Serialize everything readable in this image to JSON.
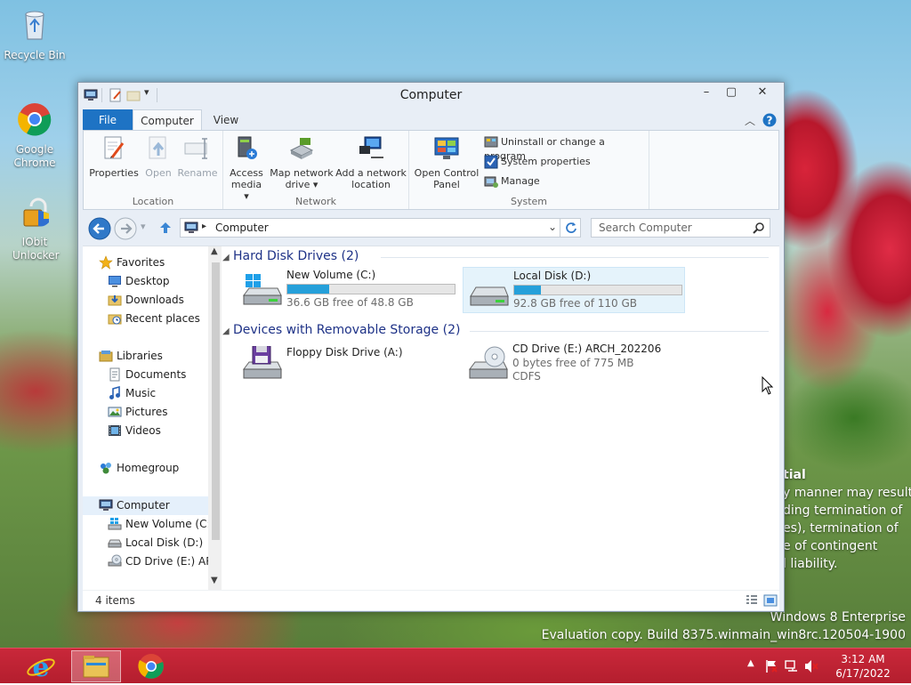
{
  "desktop": {
    "icons": [
      {
        "label": "Recycle Bin"
      },
      {
        "label": "Google Chrome"
      },
      {
        "label": "IObit Unlocker"
      }
    ],
    "watermark": {
      "line1": "Windows 8 Enterprise",
      "line2": "Evaluation copy. Build 8375.winmain_win8rc.120504-1900"
    },
    "behind_window_text": {
      "heading": "tial",
      "line1": "y manner may result",
      "line2": "ding termination of",
      "line3": "es), termination of",
      "line4": "e of contingent",
      "line5": "l liability."
    }
  },
  "window": {
    "title": "Computer",
    "controls": {
      "minimize": "–",
      "maximize": "▢",
      "close": "✕"
    },
    "tabs": [
      {
        "label": "File"
      },
      {
        "label": "Computer",
        "selected": true
      },
      {
        "label": "View"
      }
    ],
    "ribbon": {
      "location": {
        "label": "Location",
        "buttons": [
          {
            "label": "Properties",
            "enabled": true
          },
          {
            "label": "Open",
            "enabled": false
          },
          {
            "label": "Rename",
            "enabled": false
          }
        ]
      },
      "network": {
        "label": "Network",
        "buttons": [
          {
            "line1": "Access",
            "line2": "media ▾"
          },
          {
            "line1": "Map network",
            "line2": "drive ▾"
          },
          {
            "line1": "Add a network",
            "line2": "location"
          }
        ]
      },
      "system": {
        "label": "System",
        "open_cp_line1": "Open Control",
        "open_cp_line2": "Panel",
        "small": [
          {
            "label": "Uninstall or change a program"
          },
          {
            "label": "System properties"
          },
          {
            "label": "Manage"
          }
        ]
      }
    },
    "address": {
      "separator": "▸",
      "path": "Computer"
    },
    "search": {
      "placeholder": "Search Computer"
    },
    "nav_pane": {
      "favorites": {
        "label": "Favorites",
        "items": [
          "Desktop",
          "Downloads",
          "Recent places"
        ]
      },
      "libraries": {
        "label": "Libraries",
        "items": [
          "Documents",
          "Music",
          "Pictures",
          "Videos"
        ]
      },
      "homegroup": {
        "label": "Homegroup"
      },
      "computer": {
        "label": "Computer",
        "items": [
          "New Volume (C:)",
          "Local Disk (D:)",
          "CD Drive (E:) ARC"
        ]
      }
    },
    "content": {
      "groups": [
        {
          "label": "Hard Disk Drives (2)",
          "drives": [
            {
              "name": "New Volume (C:)",
              "free": "36.6 GB free of 48.8 GB",
              "used_fraction": 0.25
            },
            {
              "name": "Local Disk (D:)",
              "free": "92.8 GB free of 110 GB",
              "used_fraction": 0.16
            }
          ]
        },
        {
          "label": "Devices with Removable Storage (2)",
          "drives": [
            {
              "name": "Floppy Disk Drive (A:)"
            },
            {
              "name": "CD Drive (E:) ARCH_202206",
              "free": "0 bytes free of 775 MB",
              "fs": "CDFS"
            }
          ]
        }
      ]
    },
    "status": {
      "items": "4 items"
    }
  },
  "taskbar": {
    "clock": {
      "time": "3:12 AM",
      "date": "6/17/2022"
    }
  },
  "colors": {
    "accent": "#1e73c4",
    "taskbar": "#b41e2e",
    "drive_bar": "#26a0da",
    "group_header": "#1e3287"
  }
}
